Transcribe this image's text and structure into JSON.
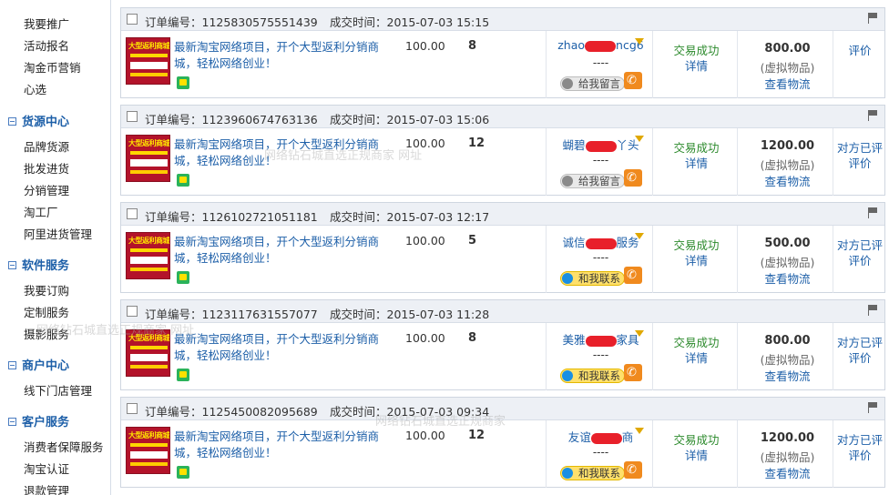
{
  "sidebar": {
    "top_items": [
      "我要推广",
      "活动报名",
      "淘金币营销",
      "心选"
    ],
    "sections": [
      {
        "title": "货源中心",
        "items": [
          "品牌货源",
          "批发进货",
          "分销管理",
          "淘工厂",
          "阿里进货管理"
        ]
      },
      {
        "title": "软件服务",
        "items": [
          "我要订购",
          "定制服务",
          "摄影服务"
        ]
      },
      {
        "title": "商户中心",
        "items": [
          "线下门店管理"
        ]
      },
      {
        "title": "客户服务",
        "items": [
          "消费者保障服务",
          "淘宝认证",
          "退款管理"
        ]
      }
    ]
  },
  "labels": {
    "order_no": "订单编号：",
    "deal_time": "成交时间：",
    "thumb_text": "大型返利商城",
    "dashes": "----",
    "detail": "详情",
    "virtual": "(虚拟物品)",
    "logistics": "查看物流",
    "leave_msg": "给我留言",
    "contact_me": "和我联系",
    "rate_simple": "评价",
    "rate_other_done": "对方已评"
  },
  "orders": [
    {
      "order_no": "1125830575551439",
      "time": "2015-07-03 15:15",
      "title": "最新淘宝网络项目，开个大型返利分销商城，轻松网络创业！",
      "price": "100.00",
      "qty": "8",
      "buyer_pre": "zhao",
      "buyer_post": "ncg6",
      "status": "交易成功",
      "amount": "800.00",
      "btn": "leave",
      "rate": "single"
    },
    {
      "order_no": "1123960674763136",
      "time": "2015-07-03 15:06",
      "title": "最新淘宝网络项目，开个大型返利分销商城，轻松网络创业！",
      "price": "100.00",
      "qty": "12",
      "buyer_pre": "蝴碧",
      "buyer_post": "丫头",
      "status": "交易成功",
      "amount": "1200.00",
      "btn": "leave",
      "rate": "double"
    },
    {
      "order_no": "1126102721051181",
      "time": "2015-07-03 12:17",
      "title": "最新淘宝网络项目，开个大型返利分销商城，轻松网络创业！",
      "price": "100.00",
      "qty": "5",
      "buyer_pre": "诚信",
      "buyer_post": "服务",
      "status": "交易成功",
      "amount": "500.00",
      "btn": "contact",
      "rate": "double"
    },
    {
      "order_no": "1123117631557077",
      "time": "2015-07-03 11:28",
      "title": "最新淘宝网络项目，开个大型返利分销商城，轻松网络创业！",
      "price": "100.00",
      "qty": "8",
      "buyer_pre": "美雅",
      "buyer_post": "家具",
      "status": "交易成功",
      "amount": "800.00",
      "btn": "contact",
      "rate": "double"
    },
    {
      "order_no": "1125450082095689",
      "time": "2015-07-03 09:34",
      "title": "最新淘宝网络项目，开个大型返利分销商城，轻松网络创业！",
      "price": "100.00",
      "qty": "12",
      "buyer_pre": "友谊",
      "buyer_post": "商",
      "status": "交易成功",
      "amount": "1200.00",
      "btn": "contact",
      "rate": "double"
    }
  ],
  "watermarks": [
    "网络钻石城直选正规商家 网址",
    "网络钻石城直选正规商家 网址",
    "网络钻石城直选正规商家"
  ]
}
